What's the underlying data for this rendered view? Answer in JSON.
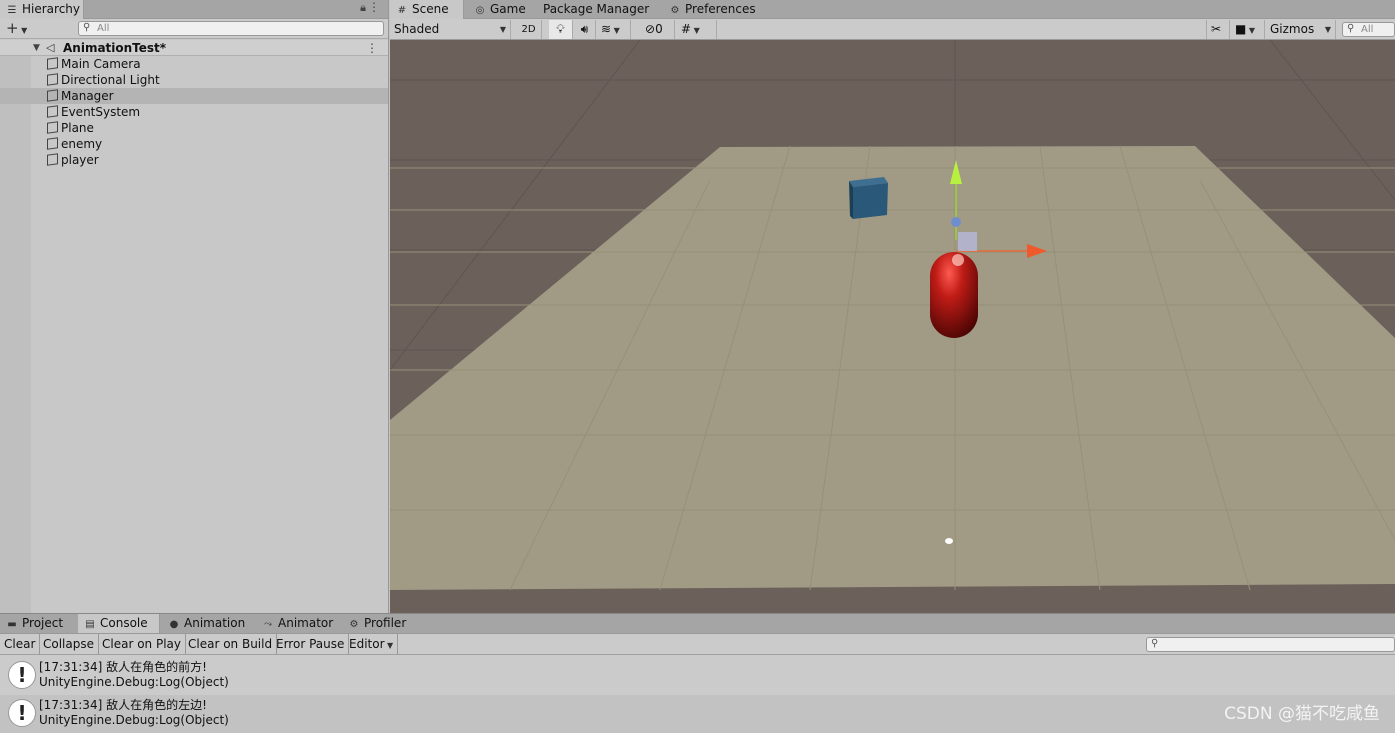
{
  "hierarchy": {
    "tab_label": "Hierarchy",
    "search_placeholder": "All",
    "scene_name": "AnimationTest*",
    "items": [
      {
        "label": "Main Camera",
        "selected": false
      },
      {
        "label": "Directional Light",
        "selected": false
      },
      {
        "label": "Manager",
        "selected": true
      },
      {
        "label": "EventSystem",
        "selected": false
      },
      {
        "label": "Plane",
        "selected": false
      },
      {
        "label": "enemy",
        "selected": false
      },
      {
        "label": "player",
        "selected": false
      }
    ]
  },
  "scene": {
    "tabs": [
      {
        "label": "Scene",
        "icon": "grid-icon",
        "active": true
      },
      {
        "label": "Game",
        "icon": "gamepad-icon",
        "active": false
      },
      {
        "label": "Package Manager",
        "icon": "",
        "active": false
      },
      {
        "label": "Preferences",
        "icon": "gear-icon",
        "active": false
      }
    ],
    "toolbar": {
      "shading_mode": "Shaded",
      "mode_2d": "2D",
      "hidden_count": "0",
      "gizmos_label": "Gizmos",
      "search_placeholder": "All"
    }
  },
  "console": {
    "tabs": [
      {
        "label": "Project",
        "icon": "folder-icon",
        "active": false
      },
      {
        "label": "Console",
        "icon": "console-icon",
        "active": true
      },
      {
        "label": "Animation",
        "icon": "clock-icon",
        "active": false
      },
      {
        "label": "Animator",
        "icon": "animator-icon",
        "active": false
      },
      {
        "label": "Profiler",
        "icon": "profiler-icon",
        "active": false
      }
    ],
    "toolbar": {
      "clear": "Clear",
      "collapse": "Collapse",
      "clear_on_play": "Clear on Play",
      "clear_on_build": "Clear on Build",
      "error_pause": "Error Pause",
      "editor": "Editor"
    },
    "logs": [
      {
        "message": "[17:31:34] 敌人在角色的前方!",
        "trace": "UnityEngine.Debug:Log(Object)"
      },
      {
        "message": "[17:31:34] 敌人在角色的左边!",
        "trace": "UnityEngine.Debug:Log(Object)"
      }
    ]
  },
  "watermark": "CSDN @猫不吃咸鱼",
  "colors": {
    "sky": "#6b605a",
    "ground": "#a19a84",
    "player": "#b81d18",
    "enemy": "#2a5878",
    "panel": "#c8c8c8"
  }
}
